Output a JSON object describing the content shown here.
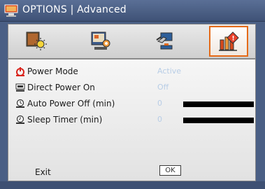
{
  "window": {
    "title": "OPTIONS | Advanced"
  },
  "tabs": [
    {
      "name": "tab-image",
      "icon": "image-sun-icon",
      "active": false
    },
    {
      "name": "tab-display",
      "icon": "display-gear-icon",
      "active": false
    },
    {
      "name": "tab-setup",
      "icon": "hand-setup-icon",
      "active": false
    },
    {
      "name": "tab-options",
      "icon": "options-chart-icon",
      "active": true
    }
  ],
  "menu": {
    "items": [
      {
        "label": "Power Mode",
        "value": "Active",
        "icon": "power-icon",
        "has_bar": false
      },
      {
        "label": "Direct Power On",
        "value": "Off",
        "icon": "power-on-icon",
        "has_bar": false
      },
      {
        "label": "Auto Power Off (min)",
        "value": "0",
        "icon": "timer-icon",
        "has_bar": true,
        "level": 0
      },
      {
        "label": "Sleep Timer (min)",
        "value": "0",
        "icon": "sleep-timer-icon",
        "has_bar": true,
        "level": 0
      }
    ],
    "exit_label": "Exit",
    "ok_label": "OK"
  },
  "colors": {
    "frame": "#4a5f85",
    "accent": "#e56a17",
    "value_text": "#b8cde6"
  }
}
